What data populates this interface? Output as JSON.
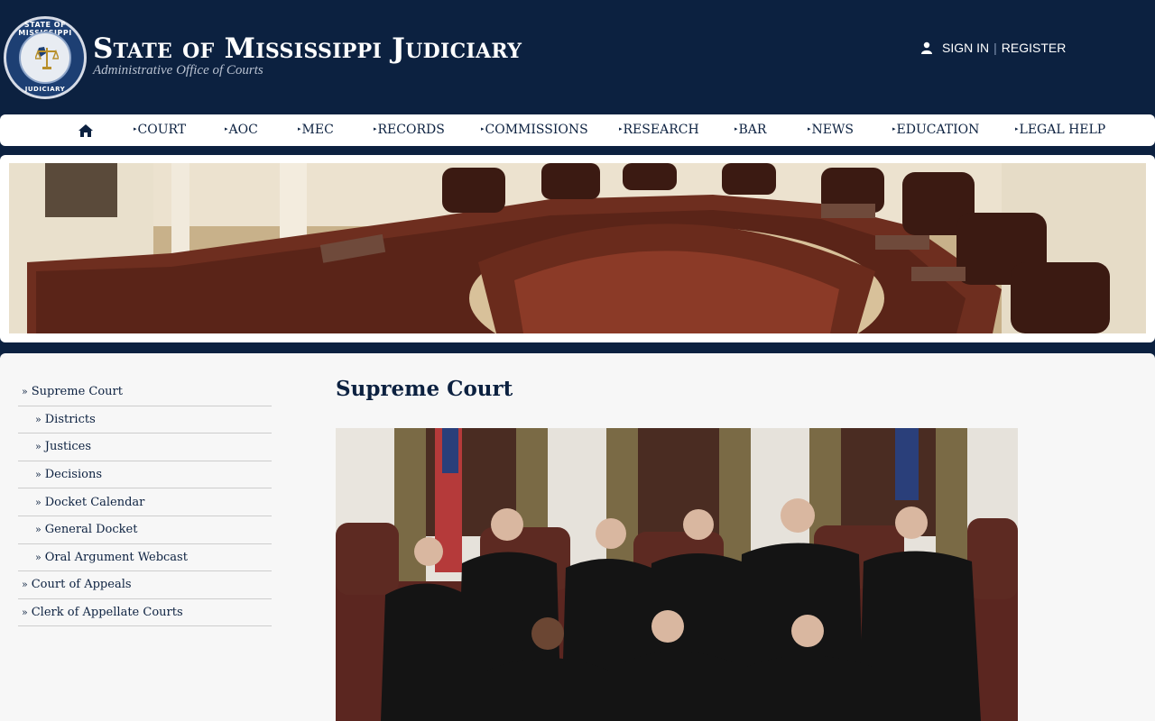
{
  "header": {
    "seal_top_text": "STATE OF MISSISSIPPI",
    "seal_bottom_text": "JUDICIARY",
    "title": "State of Mississippi Judiciary",
    "subtitle": "Administrative Office of Courts",
    "sign_in": "SIGN IN",
    "separator": "|",
    "register": "REGISTER"
  },
  "nav": {
    "home_icon": "home-icon",
    "items": [
      "COURT",
      "AOC",
      "MEC",
      "RECORDS",
      "COMMISSIONS",
      "RESEARCH",
      "BAR",
      "NEWS",
      "EDUCATION",
      "LEGAL HELP"
    ]
  },
  "sidebar": {
    "items": [
      {
        "label": "Supreme Court",
        "level": 0
      },
      {
        "label": "Districts",
        "level": 1
      },
      {
        "label": "Justices",
        "level": 1
      },
      {
        "label": "Decisions",
        "level": 1
      },
      {
        "label": "Docket Calendar",
        "level": 1
      },
      {
        "label": "General Docket",
        "level": 1
      },
      {
        "label": "Oral Argument Webcast",
        "level": 1
      },
      {
        "label": "Court of Appeals",
        "level": 0
      },
      {
        "label": "Clerk of Appellate Courts",
        "level": 0
      }
    ]
  },
  "main": {
    "title": "Supreme Court"
  },
  "colors": {
    "navy": "#0c2140",
    "content_bg": "#f7f7f7"
  }
}
